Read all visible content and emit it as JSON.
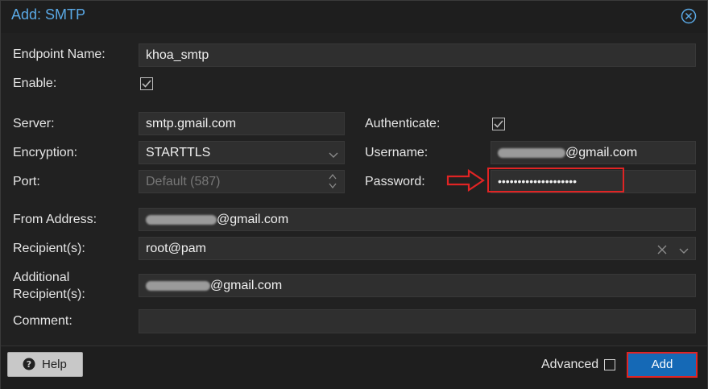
{
  "dialog": {
    "title": "Add: SMTP",
    "close_icon": "circle-x-icon"
  },
  "form": {
    "endpoint_name": {
      "label": "Endpoint Name:",
      "value": "khoa_smtp"
    },
    "enable": {
      "label": "Enable:",
      "checked": true
    },
    "server": {
      "label": "Server:",
      "value": "smtp.gmail.com"
    },
    "encryption": {
      "label": "Encryption:",
      "value": "STARTTLS"
    },
    "port": {
      "label": "Port:",
      "placeholder": "Default (587)"
    },
    "authenticate": {
      "label": "Authenticate:",
      "checked": true
    },
    "username": {
      "label": "Username:",
      "value_visible_part": "@gmail.com"
    },
    "password": {
      "label": "Password:",
      "masked_value": "••••••••••••••••••••"
    },
    "from_address": {
      "label": "From Address:",
      "value_visible_part": "@gmail.com"
    },
    "recipients": {
      "label": "Recipient(s):",
      "value": "root@pam"
    },
    "additional_recipients": {
      "label_line1": "Additional",
      "label_line2": "Recipient(s):",
      "value_visible_part": "@gmail.com"
    },
    "comment": {
      "label": "Comment:",
      "value": ""
    }
  },
  "footer": {
    "help_label": "Help",
    "advanced_label": "Advanced",
    "advanced_checked": false,
    "add_label": "Add"
  },
  "colors": {
    "accent": "#5aa9e6",
    "primary_button": "#1569b6",
    "highlight": "#e02424"
  }
}
